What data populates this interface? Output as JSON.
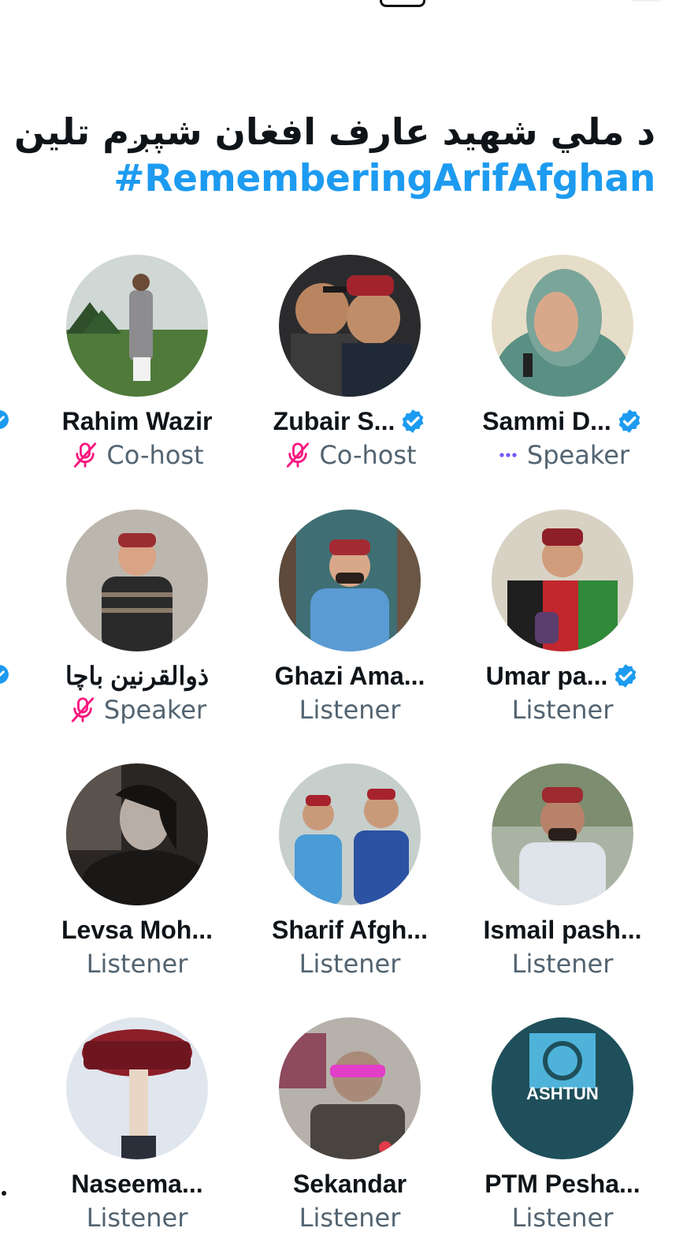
{
  "header": {
    "title_pashto": "د ملي شهيد عارف افغان شپږم تلين",
    "hashtag": "#RememberingArifAfghan"
  },
  "colors": {
    "accent_blue": "#1d9bf0",
    "verified_blue": "#1d9bf0",
    "muted_pink": "#f91880",
    "speaking_purple": "#7856ff",
    "text_primary": "#0f1419",
    "text_secondary": "#536471"
  },
  "participants": [
    {
      "name": "Rahim Wazir",
      "role": "Co-host",
      "verified": false,
      "role_icon": "mic-muted-icon"
    },
    {
      "name": "Zubair S...",
      "role": "Co-host",
      "verified": true,
      "role_icon": "mic-muted-icon"
    },
    {
      "name": "Sammi D...",
      "role": "Speaker",
      "verified": true,
      "role_icon": "speaking-dots-icon"
    },
    {
      "name": "ذوالقرنين باچا",
      "role": "Speaker",
      "verified": false,
      "role_icon": "mic-muted-icon"
    },
    {
      "name": "Ghazi Ama...",
      "role": "Listener",
      "verified": false,
      "role_icon": ""
    },
    {
      "name": "Umar pa...",
      "role": "Listener",
      "verified": true,
      "role_icon": ""
    },
    {
      "name": "Levsa Moh...",
      "role": "Listener",
      "verified": false,
      "role_icon": ""
    },
    {
      "name": "Sharif Afgh...",
      "role": "Listener",
      "verified": false,
      "role_icon": ""
    },
    {
      "name": "Ismail pash...",
      "role": "Listener",
      "verified": false,
      "role_icon": ""
    },
    {
      "name": "Naseema...",
      "role": "Listener",
      "verified": false,
      "role_icon": ""
    },
    {
      "name": "Sekandar",
      "role": "Listener",
      "verified": false,
      "role_icon": ""
    },
    {
      "name": "PTM Pesha...",
      "role": "Listener",
      "verified": false,
      "role_icon": ""
    }
  ],
  "avatar_logo_text": "ASHTUN"
}
